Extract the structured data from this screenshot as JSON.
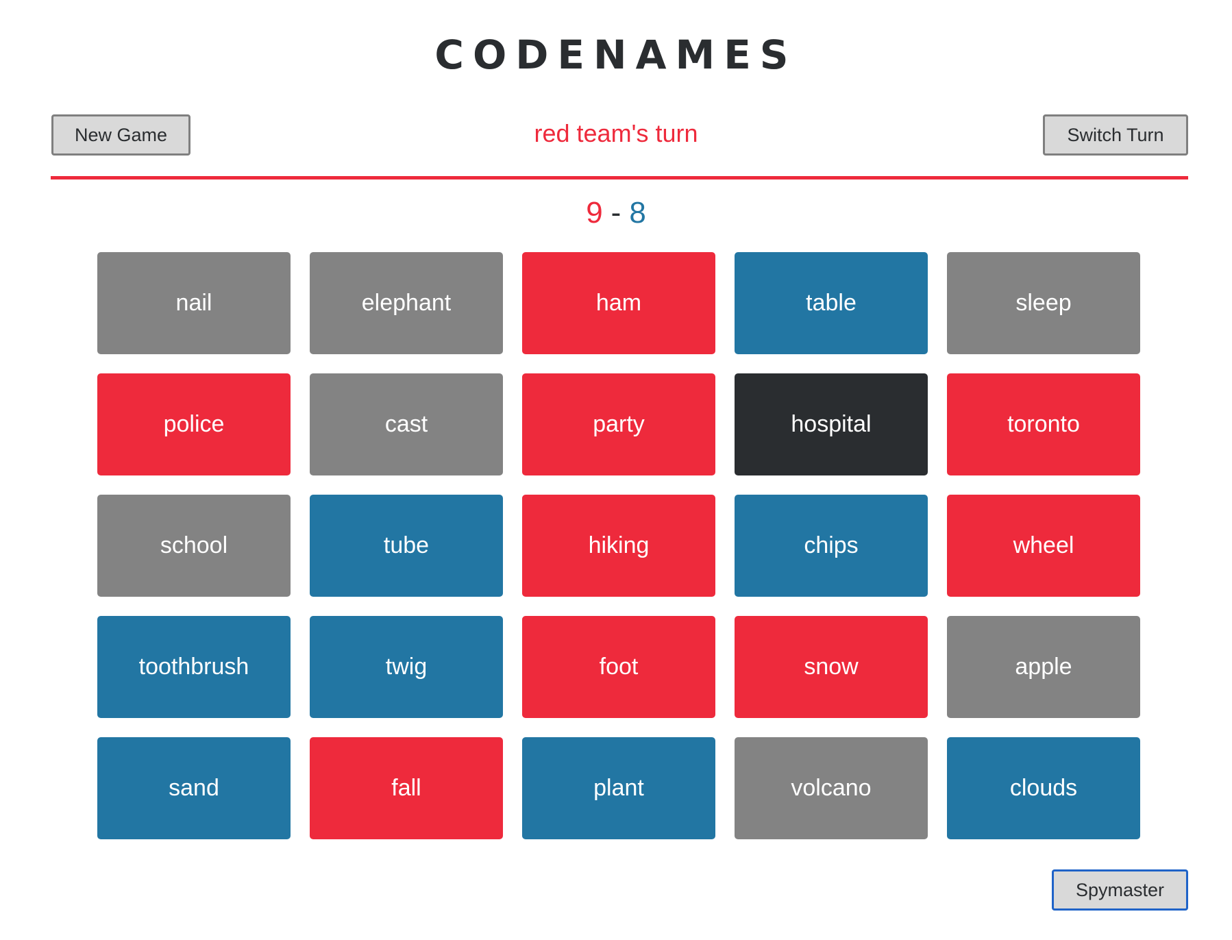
{
  "title": "CODENAMES",
  "toolbar": {
    "new_game_label": "New Game",
    "turn_text": "red team's turn",
    "switch_turn_label": "Switch Turn"
  },
  "score": {
    "red": "9",
    "separator": "-",
    "blue": "8"
  },
  "colors": {
    "red": "#ee2a3c",
    "blue": "#2276a3",
    "neutral": "#838383",
    "assassin": "#2a2d30"
  },
  "cards": [
    {
      "word": "nail",
      "team": "neutral"
    },
    {
      "word": "elephant",
      "team": "neutral"
    },
    {
      "word": "ham",
      "team": "red"
    },
    {
      "word": "table",
      "team": "blue"
    },
    {
      "word": "sleep",
      "team": "neutral"
    },
    {
      "word": "police",
      "team": "red"
    },
    {
      "word": "cast",
      "team": "neutral"
    },
    {
      "word": "party",
      "team": "red"
    },
    {
      "word": "hospital",
      "team": "assassin"
    },
    {
      "word": "toronto",
      "team": "red"
    },
    {
      "word": "school",
      "team": "neutral"
    },
    {
      "word": "tube",
      "team": "blue"
    },
    {
      "word": "hiking",
      "team": "red"
    },
    {
      "word": "chips",
      "team": "blue"
    },
    {
      "word": "wheel",
      "team": "red"
    },
    {
      "word": "toothbrush",
      "team": "blue"
    },
    {
      "word": "twig",
      "team": "blue"
    },
    {
      "word": "foot",
      "team": "red"
    },
    {
      "word": "snow",
      "team": "red"
    },
    {
      "word": "apple",
      "team": "neutral"
    },
    {
      "word": "sand",
      "team": "blue"
    },
    {
      "word": "fall",
      "team": "red"
    },
    {
      "word": "plant",
      "team": "blue"
    },
    {
      "word": "volcano",
      "team": "neutral"
    },
    {
      "word": "clouds",
      "team": "blue"
    }
  ],
  "footer": {
    "spymaster_label": "Spymaster"
  }
}
